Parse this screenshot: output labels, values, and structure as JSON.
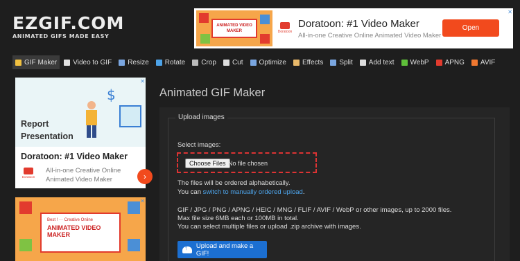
{
  "logo": {
    "main": "EZGIF.COM",
    "tagline": "ANIMATED GIFS MADE EASY"
  },
  "banner_ad": {
    "title": "Doratoon: #1 Video Maker",
    "description": "All-in-one Creative Online Animated Video Maker",
    "button": "Open",
    "brand": "Doratoon",
    "art_caption": "ANIMATED VIDEO MAKER",
    "close": "✕"
  },
  "nav": [
    {
      "label": "GIF Maker",
      "icon": "gif-maker-icon",
      "color": "#f0c040"
    },
    {
      "label": "Video to GIF",
      "icon": "video-icon",
      "color": "#e0e0e0"
    },
    {
      "label": "Resize",
      "icon": "resize-icon",
      "color": "#7aa6e0"
    },
    {
      "label": "Rotate",
      "icon": "rotate-icon",
      "color": "#4da3e8"
    },
    {
      "label": "Crop",
      "icon": "crop-icon",
      "color": "#bbbbbb"
    },
    {
      "label": "Cut",
      "icon": "cut-icon",
      "color": "#dddddd"
    },
    {
      "label": "Optimize",
      "icon": "optimize-icon",
      "color": "#7aa6e0"
    },
    {
      "label": "Effects",
      "icon": "effects-icon",
      "color": "#e8b86a"
    },
    {
      "label": "Split",
      "icon": "split-icon",
      "color": "#7aa6e0"
    },
    {
      "label": "Add text",
      "icon": "add-text-icon",
      "color": "#dddddd"
    },
    {
      "label": "WebP",
      "icon": "webp-icon",
      "color": "#5fbf3a"
    },
    {
      "label": "APNG",
      "icon": "apng-icon",
      "color": "#e23b2e"
    },
    {
      "label": "AVIF",
      "icon": "avif-icon",
      "color": "#f07830"
    }
  ],
  "side_ad_1": {
    "headline": "Report\nPresentation",
    "title": "Doratoon: #1 Video Maker",
    "description": "All-in-one Creative Online Animated Video Maker",
    "brand": "Doratoon",
    "go": "›"
  },
  "side_ad_2": {
    "line1": "Best ! ··· Creative Online",
    "line2": "ANIMATED VIDEO MAKER"
  },
  "main": {
    "title": "Animated GIF Maker",
    "legend": "Upload images",
    "select_label": "Select images:",
    "file_button": "Choose Files",
    "file_status": "No file chosen",
    "order_note": "The files will be ordered alphabetically.",
    "switch_prefix": "You can ",
    "switch_link": "switch to manually ordered upload",
    "switch_suffix": ".",
    "formats": "GIF / JPG / PNG / APNG / HEIC / MNG / FLIF / AVIF / WebP or other images, up to 2000 files.",
    "max_size": "Max file size 6MB each or 100MB in total.",
    "multi_note": "You can select multiple files or upload .zip archive with images.",
    "upload_button": "Upload and make a GIF!"
  },
  "colors": {
    "background": "#1e1e1e",
    "panel": "#252525",
    "accent": "#1c6fd1",
    "link": "#4da3e8",
    "highlight": "#dd3333"
  }
}
